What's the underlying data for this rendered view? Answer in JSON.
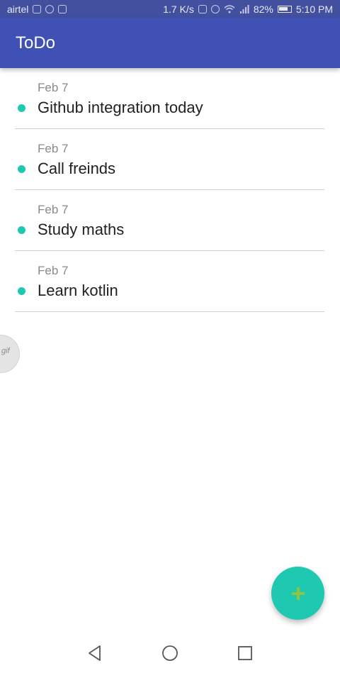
{
  "status_bar": {
    "carrier": "airtel",
    "speed": "1.7 K/s",
    "battery": "82%",
    "time": "5:10 PM",
    "icons": [
      "signal-icon",
      "whatsapp-icon",
      "notification-icon",
      "nfc-icon",
      "alarm-icon",
      "wifi-icon",
      "cell-signal-icon",
      "battery-icon"
    ]
  },
  "app_bar": {
    "title": "ToDo",
    "color": "#3f51b5"
  },
  "todos": [
    {
      "date": "Feb 7",
      "title": "Github integration today"
    },
    {
      "date": "Feb 7",
      "title": "Call freinds"
    },
    {
      "date": "Feb 7",
      "title": "Study maths"
    },
    {
      "date": "Feb 7",
      "title": "Learn kotlin"
    }
  ],
  "gif_bubble": {
    "label": "gif"
  },
  "fab": {
    "icon": "plus-icon",
    "color": "#1fc8b0"
  },
  "nav_bar": {
    "buttons": [
      "back-icon",
      "home-icon",
      "recents-icon"
    ]
  },
  "colors": {
    "accent": "#1fc8b0",
    "primary": "#3f51b5"
  }
}
